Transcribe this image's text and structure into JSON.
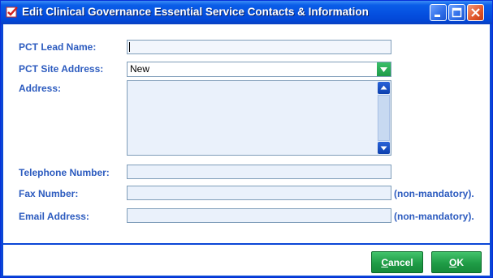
{
  "window": {
    "title": "Edit Clinical Governance Essential Service Contacts & Information"
  },
  "form": {
    "pct_lead_name_label": "PCT Lead Name:",
    "pct_lead_name_value": "",
    "pct_site_address_label": "PCT Site Address:",
    "pct_site_address_value": "New",
    "address_label": "Address:",
    "address_value": "",
    "telephone_label": "Telephone Number:",
    "telephone_value": "",
    "fax_label": "Fax Number:",
    "fax_value": "",
    "fax_note": "(non-mandatory).",
    "email_label": "Email Address:",
    "email_value": "",
    "email_note": "(non-mandatory)."
  },
  "buttons": {
    "cancel_first": "C",
    "cancel_rest": "ancel",
    "ok_first": "O",
    "ok_rest": "K"
  },
  "colors": {
    "title_bar": "#0550e0",
    "label_text": "#2c5bbf",
    "button_green": "#1f9c46",
    "field_bg": "#eaf1fb"
  },
  "icons": {
    "title": "edit-check-icon",
    "minimize": "minimize-icon",
    "maximize": "maximize-icon",
    "close": "close-icon",
    "dropdown": "chevron-down-icon",
    "scroll_up": "arrow-up-icon",
    "scroll_down": "arrow-down-icon"
  }
}
